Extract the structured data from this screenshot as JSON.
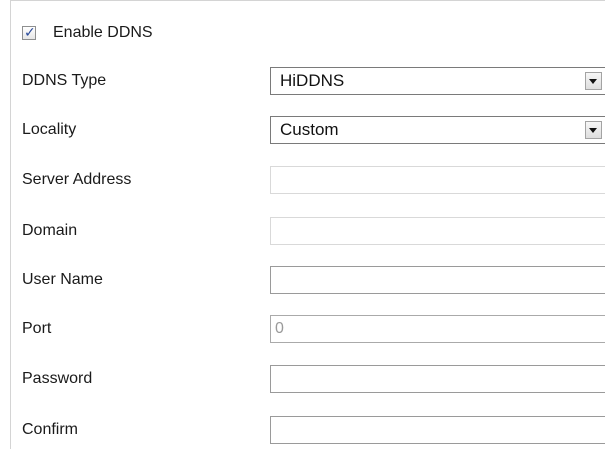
{
  "ddns": {
    "enable": {
      "label": "Enable DDNS",
      "checked": true
    },
    "fields": {
      "ddns_type": {
        "label": "DDNS Type",
        "value": "HiDDNS"
      },
      "locality": {
        "label": "Locality",
        "value": "Custom"
      },
      "server_address": {
        "label": "Server Address",
        "value": ""
      },
      "domain": {
        "label": "Domain",
        "value": ""
      },
      "user_name": {
        "label": "User Name",
        "value": ""
      },
      "port": {
        "label": "Port",
        "value": "0"
      },
      "password": {
        "label": "Password",
        "value": ""
      },
      "confirm": {
        "label": "Confirm",
        "value": ""
      }
    }
  },
  "icons": {
    "checkbox_check": "check-mark",
    "dropdown": "chevron-down"
  }
}
